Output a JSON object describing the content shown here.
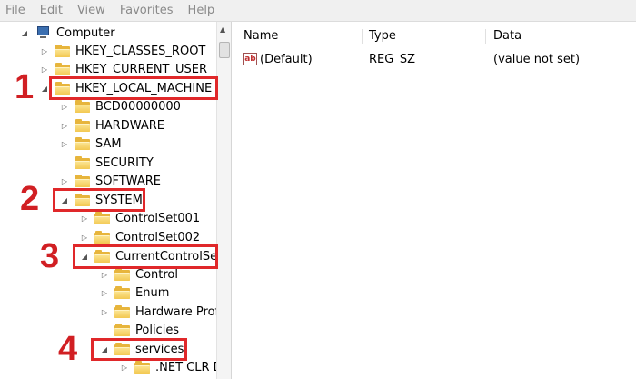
{
  "menu": [
    "File",
    "Edit",
    "View",
    "Favorites",
    "Help"
  ],
  "tree": {
    "root": "Computer",
    "hives": [
      "HKEY_CLASSES_ROOT",
      "HKEY_CURRENT_USER",
      "HKEY_LOCAL_MACHINE"
    ],
    "hklm_children": [
      "BCD00000000",
      "HARDWARE",
      "SAM",
      "SECURITY",
      "SOFTWARE",
      "SYSTEM"
    ],
    "system_children": [
      "ControlSet001",
      "ControlSet002",
      "CurrentControlSet"
    ],
    "ccs_children": [
      "Control",
      "Enum",
      "Hardware Prof",
      "Policies",
      "services"
    ],
    "services_children": [
      ".NET CLR D"
    ]
  },
  "values": {
    "columns": [
      "Name",
      "Type",
      "Data"
    ],
    "rows": [
      {
        "name": "(Default)",
        "type": "REG_SZ",
        "data": "(value not set)"
      }
    ]
  },
  "annotations": [
    "1",
    "2",
    "3",
    "4"
  ],
  "colors": {
    "highlight": "#e0282a",
    "folder": "#f3c851"
  }
}
